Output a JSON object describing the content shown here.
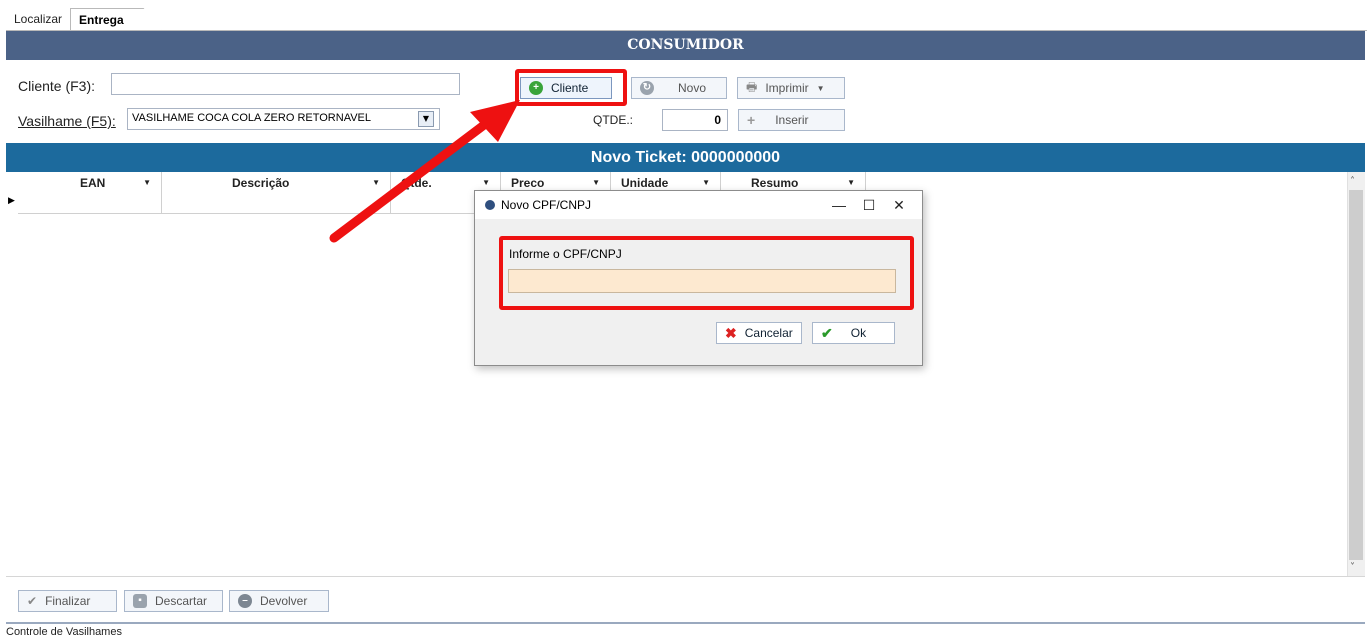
{
  "tabs": {
    "localizar": "Localizar",
    "entrega": "Entrega"
  },
  "consumidor": {
    "title": "CONSUMIDOR",
    "cliente_label": "Cliente (F3):",
    "cliente_value": "",
    "vasilhame_label": "Vasilhame (F5):",
    "vasilhame_value": "VASILHAME COCA COLA ZERO RETORNAVEL",
    "qtde_label": "QTDE.:",
    "qtde_value": "0",
    "buttons": {
      "cliente": "Cliente",
      "novo": "Novo",
      "imprimir": "Imprimir",
      "inserir": "Inserir"
    }
  },
  "ticket": {
    "title": "Novo Ticket: 0000000000",
    "columns": [
      "EAN",
      "Descrição",
      "Qtde.",
      "Preco",
      "Unidade",
      "Resumo"
    ]
  },
  "footer": {
    "finalizar": "Finalizar",
    "descartar": "Descartar",
    "devolver": "Devolver",
    "bottom_tab": "Controle de Vasilhames"
  },
  "dialog": {
    "title": "Novo CPF/CNPJ",
    "field_label": "Informe o CPF/CNPJ",
    "field_value": "",
    "cancel": "Cancelar",
    "ok": "Ok"
  },
  "colors": {
    "band_consumidor": "#4b6287",
    "band_ticket": "#1c6a9d",
    "highlight": "#e11111",
    "input_focus_bg": "#fde9d0"
  }
}
